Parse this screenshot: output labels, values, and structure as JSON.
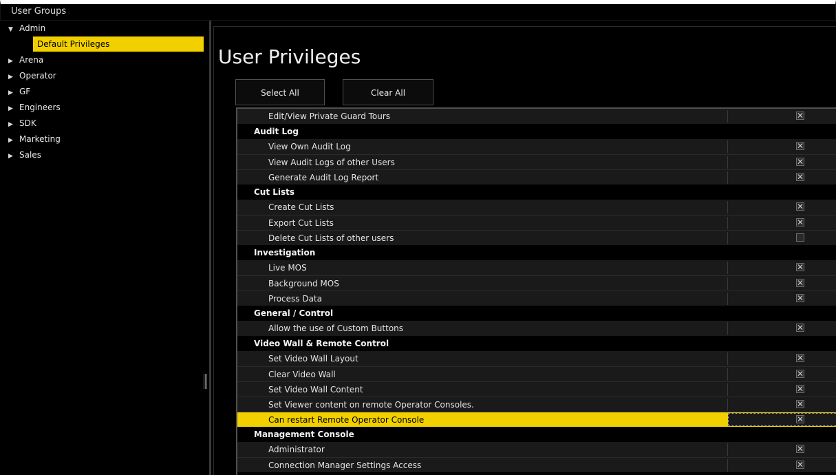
{
  "window": {
    "title": "User Groups"
  },
  "sidebar": {
    "groups": [
      {
        "label": "Admin",
        "expanded": true,
        "children": [
          "Default Privileges"
        ]
      },
      {
        "label": "Arena",
        "expanded": false
      },
      {
        "label": "Operator",
        "expanded": false
      },
      {
        "label": "GF",
        "expanded": false
      },
      {
        "label": "Engineers",
        "expanded": false
      },
      {
        "label": "SDK",
        "expanded": false
      },
      {
        "label": "Marketing",
        "expanded": false
      },
      {
        "label": "Sales",
        "expanded": false
      }
    ],
    "selected": "Default Privileges",
    "expanded_arrow": "▼",
    "collapsed_arrow": "▶"
  },
  "main": {
    "title": "User Privileges",
    "buttons": {
      "select_all": "Select All",
      "clear_all": "Clear All"
    },
    "rows": [
      {
        "type": "item",
        "label": "Edit/View Private Guard Tours",
        "checked": true
      },
      {
        "type": "group",
        "label": "Audit Log"
      },
      {
        "type": "item",
        "label": "View Own Audit Log",
        "checked": true
      },
      {
        "type": "item",
        "label": "View Audit Logs of other Users",
        "checked": true
      },
      {
        "type": "item",
        "label": "Generate Audit Log Report",
        "checked": true
      },
      {
        "type": "group",
        "label": "Cut Lists"
      },
      {
        "type": "item",
        "label": "Create Cut Lists",
        "checked": true
      },
      {
        "type": "item",
        "label": "Export Cut Lists",
        "checked": true
      },
      {
        "type": "item",
        "label": "Delete Cut Lists of other users",
        "checked": false
      },
      {
        "type": "group",
        "label": "Investigation"
      },
      {
        "type": "item",
        "label": "Live MOS",
        "checked": true
      },
      {
        "type": "item",
        "label": "Background MOS",
        "checked": true
      },
      {
        "type": "item",
        "label": "Process Data",
        "checked": true
      },
      {
        "type": "group",
        "label": "General / Control"
      },
      {
        "type": "item",
        "label": "Allow the use of Custom Buttons",
        "checked": true
      },
      {
        "type": "group",
        "label": "Video Wall & Remote Control"
      },
      {
        "type": "item",
        "label": "Set Video Wall Layout",
        "checked": true
      },
      {
        "type": "item",
        "label": "Clear Video Wall",
        "checked": true
      },
      {
        "type": "item",
        "label": "Set Video Wall Content",
        "checked": true
      },
      {
        "type": "item",
        "label": "Set Viewer content on remote Operator Consoles.",
        "checked": true
      },
      {
        "type": "item",
        "label": "Can restart Remote Operator Console",
        "checked": true,
        "selected": true
      },
      {
        "type": "group",
        "label": "Management Console"
      },
      {
        "type": "item",
        "label": "Administrator",
        "checked": true
      },
      {
        "type": "item",
        "label": "Connection Manager Settings Access",
        "checked": true
      }
    ],
    "check_mark": "✕"
  },
  "colors": {
    "highlight": "#f2d000",
    "background": "#000000",
    "row": "#1a1a1a"
  }
}
